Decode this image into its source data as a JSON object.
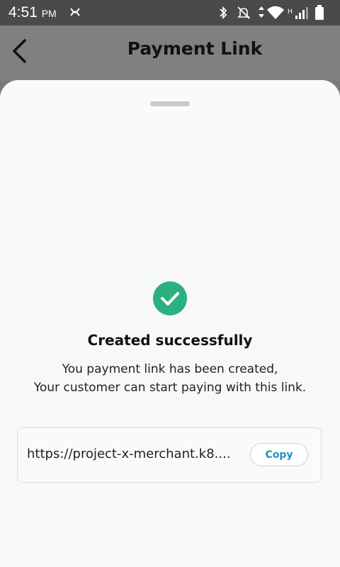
{
  "status_bar": {
    "time": "4:51",
    "ampm": "PM",
    "left_icon": "signal-broadcast-icon",
    "right_icons": [
      "bluetooth-icon",
      "silent-bell-icon",
      "data-arrows-icon",
      "wifi-icon",
      "cell-signal-icon",
      "battery-icon"
    ],
    "network_type": "H"
  },
  "header": {
    "title": "Payment Link",
    "back_icon": "back-arrow-icon"
  },
  "sheet": {
    "status_icon": "check-circle-icon",
    "title": "Created successfully",
    "description_line1": "You payment link has been created,",
    "description_line2": "Your customer can start paying with this link.",
    "link": "https://project-x-merchant.k8....",
    "copy_label": "Copy"
  },
  "colors": {
    "success": "#2bb07f",
    "accent_link": "#1c8fc8",
    "status_bar": "#4a4a4a",
    "overlay": "#808080"
  }
}
